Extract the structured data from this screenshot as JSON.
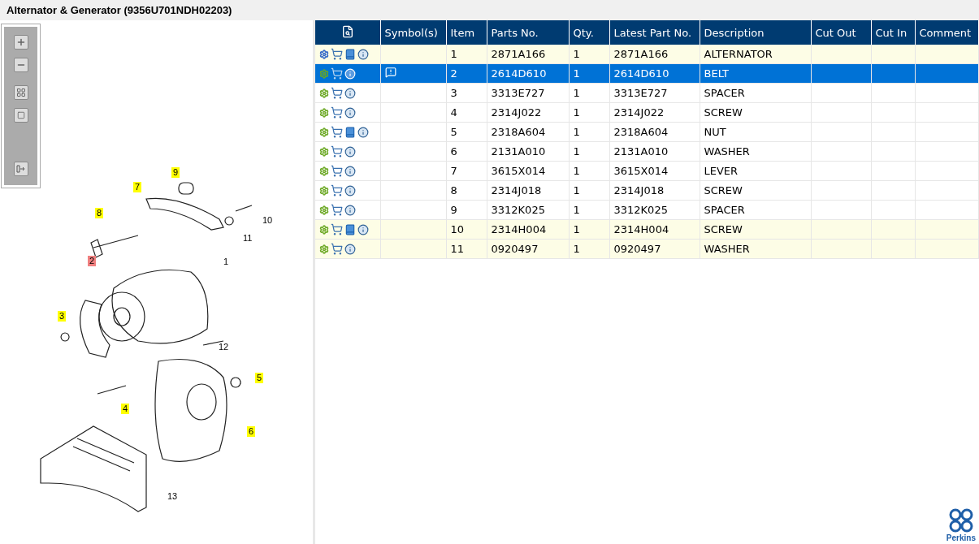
{
  "title": "Alternator & Generator (9356U701NDH02203)",
  "callouts": [
    {
      "label": "9",
      "selected": false,
      "highlighted": true
    },
    {
      "label": "7",
      "selected": false,
      "highlighted": true
    },
    {
      "label": "8",
      "selected": false,
      "highlighted": true
    },
    {
      "label": "10",
      "selected": false,
      "highlighted": false
    },
    {
      "label": "11",
      "selected": false,
      "highlighted": false
    },
    {
      "label": "2",
      "selected": true,
      "highlighted": false
    },
    {
      "label": "1",
      "selected": false,
      "highlighted": false
    },
    {
      "label": "3",
      "selected": false,
      "highlighted": true
    },
    {
      "label": "12",
      "selected": false,
      "highlighted": false
    },
    {
      "label": "5",
      "selected": false,
      "highlighted": true
    },
    {
      "label": "4",
      "selected": false,
      "highlighted": true
    },
    {
      "label": "6",
      "selected": false,
      "highlighted": true
    },
    {
      "label": "13",
      "selected": false,
      "highlighted": false
    }
  ],
  "table": {
    "columns": [
      "",
      "Symbol(s)",
      "Item",
      "Parts No.",
      "Qty.",
      "Latest Part No.",
      "Description",
      "Cut Out",
      "Cut In",
      "Comment"
    ],
    "rows": [
      {
        "selected": false,
        "highlighted": true,
        "multi_gear": true,
        "book": true,
        "note": false,
        "cells": [
          "",
          "",
          "1",
          "2871A166",
          "1",
          "2871A166",
          "ALTERNATOR"
        ]
      },
      {
        "selected": true,
        "highlighted": false,
        "multi_gear": false,
        "book": false,
        "note": true,
        "cells": [
          "",
          "",
          "2",
          "2614D610",
          "1",
          "2614D610",
          "BELT"
        ]
      },
      {
        "selected": false,
        "highlighted": false,
        "multi_gear": false,
        "book": false,
        "note": false,
        "cells": [
          "",
          "",
          "3",
          "3313E727",
          "1",
          "3313E727",
          "SPACER"
        ]
      },
      {
        "selected": false,
        "highlighted": false,
        "multi_gear": false,
        "book": false,
        "note": false,
        "cells": [
          "",
          "",
          "4",
          "2314J022",
          "1",
          "2314J022",
          "SCREW"
        ]
      },
      {
        "selected": false,
        "highlighted": false,
        "multi_gear": false,
        "book": true,
        "note": false,
        "cells": [
          "",
          "",
          "5",
          "2318A604",
          "1",
          "2318A604",
          "NUT"
        ]
      },
      {
        "selected": false,
        "highlighted": false,
        "multi_gear": false,
        "book": false,
        "note": false,
        "cells": [
          "",
          "",
          "6",
          "2131A010",
          "1",
          "2131A010",
          "WASHER"
        ]
      },
      {
        "selected": false,
        "highlighted": false,
        "multi_gear": false,
        "book": false,
        "note": false,
        "cells": [
          "",
          "",
          "7",
          "3615X014",
          "1",
          "3615X014",
          "LEVER"
        ]
      },
      {
        "selected": false,
        "highlighted": false,
        "multi_gear": false,
        "book": false,
        "note": false,
        "cells": [
          "",
          "",
          "8",
          "2314J018",
          "1",
          "2314J018",
          "SCREW"
        ]
      },
      {
        "selected": false,
        "highlighted": false,
        "multi_gear": false,
        "book": false,
        "note": false,
        "cells": [
          "",
          "",
          "9",
          "3312K025",
          "1",
          "3312K025",
          "SPACER"
        ]
      },
      {
        "selected": false,
        "highlighted": true,
        "multi_gear": false,
        "book": true,
        "note": false,
        "cells": [
          "",
          "",
          "10",
          "2314H004",
          "1",
          "2314H004",
          "SCREW"
        ]
      },
      {
        "selected": false,
        "highlighted": true,
        "multi_gear": false,
        "book": false,
        "note": false,
        "cells": [
          "",
          "",
          "11",
          "0920497",
          "1",
          "0920497",
          "WASHER"
        ]
      }
    ]
  },
  "logo": "Perkins"
}
